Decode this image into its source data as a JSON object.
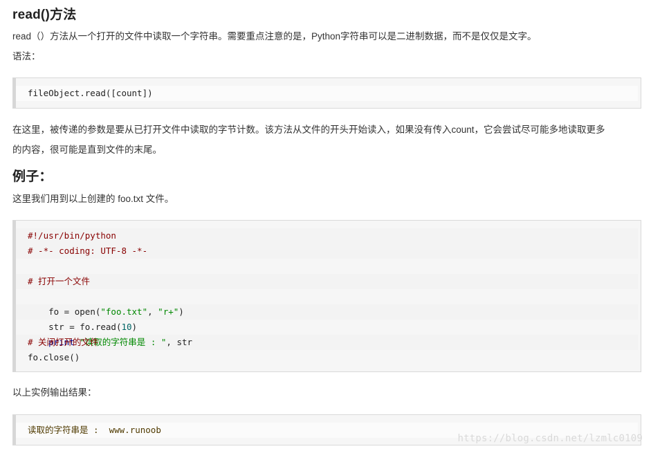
{
  "section": {
    "title": "read()方法"
  },
  "paragraphs": {
    "intro": "read（）方法从一个打开的文件中读取一个字符串。需要重点注意的是，Python字符串可以是二进制数据，而不是仅仅是文字。",
    "syntax_label": "语法：",
    "explanation_line1": "在这里，被传递的参数是要从已打开文件中读取的字节计数。该方法从文件的开头开始读入，如果没有传入count，它会尝试尽可能多地读取更多",
    "explanation_line2": "的内容，很可能是直到文件的末尾。",
    "example_heading": "例子：",
    "example_intro": "这里我们用到以上创建的 foo.txt 文件。",
    "output_label": "以上实例输出结果："
  },
  "syntax_code": {
    "line": "fileObject.read([count])"
  },
  "example_code": {
    "lines": [
      "#!/usr/bin/python",
      "# -*- coding: UTF-8 -*-",
      "",
      "# 打开一个文件",
      "fo = open(\"foo.txt\", \"r+\")",
      "str = fo.read(10)",
      "print \"读取的字符串是 : \", str",
      "# 关闭打开的文件",
      "fo.close()"
    ]
  },
  "output_code": {
    "line": "读取的字符串是 :  www.runoob"
  },
  "watermark": {
    "text": "https://blog.csdn.net/lzmlc0109"
  },
  "colors": {
    "comment": "#880000",
    "string": "#008800",
    "number": "#006666",
    "keyword": "#000088"
  }
}
